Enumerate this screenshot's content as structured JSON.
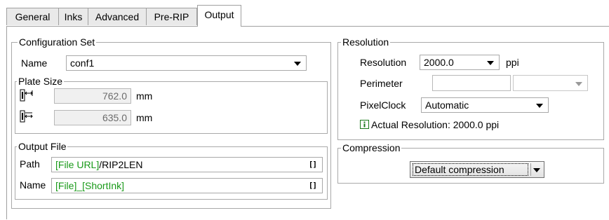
{
  "tabs": [
    {
      "label": "General"
    },
    {
      "label": "Inks"
    },
    {
      "label": "Advanced"
    },
    {
      "label": "Pre-RIP"
    },
    {
      "label": "Output",
      "active": true
    }
  ],
  "configuration_set": {
    "title": "Configuration Set",
    "name_label": "Name",
    "name_value": "conf1",
    "plate_size": {
      "title": "Plate Size",
      "width_value": "762.0",
      "width_unit": "mm",
      "height_value": "635.0",
      "height_unit": "mm",
      "width_icon": "plate-width-icon",
      "height_icon": "plate-height-icon"
    },
    "output_file": {
      "title": "Output File",
      "path_label": "Path",
      "path_token": "[File URL]",
      "path_text": "/RIP2LEN",
      "name_label": "Name",
      "name_value": "[File]_[ShortInk]",
      "token_button": "[]",
      "token_color": "#1a9a1a"
    }
  },
  "resolution": {
    "title": "Resolution",
    "resolution_label": "Resolution",
    "resolution_value": "2000.0",
    "resolution_unit": "ppi",
    "perimeter_label": "Perimeter",
    "perimeter_value": "",
    "perimeter_unit": "",
    "pixelclock_label": "PixelClock",
    "pixelclock_value": "Automatic",
    "info_icon": "info-icon",
    "actual_text": "Actual Resolution: 2000.0  ppi"
  },
  "compression": {
    "title": "Compression",
    "value": "Default compression"
  }
}
